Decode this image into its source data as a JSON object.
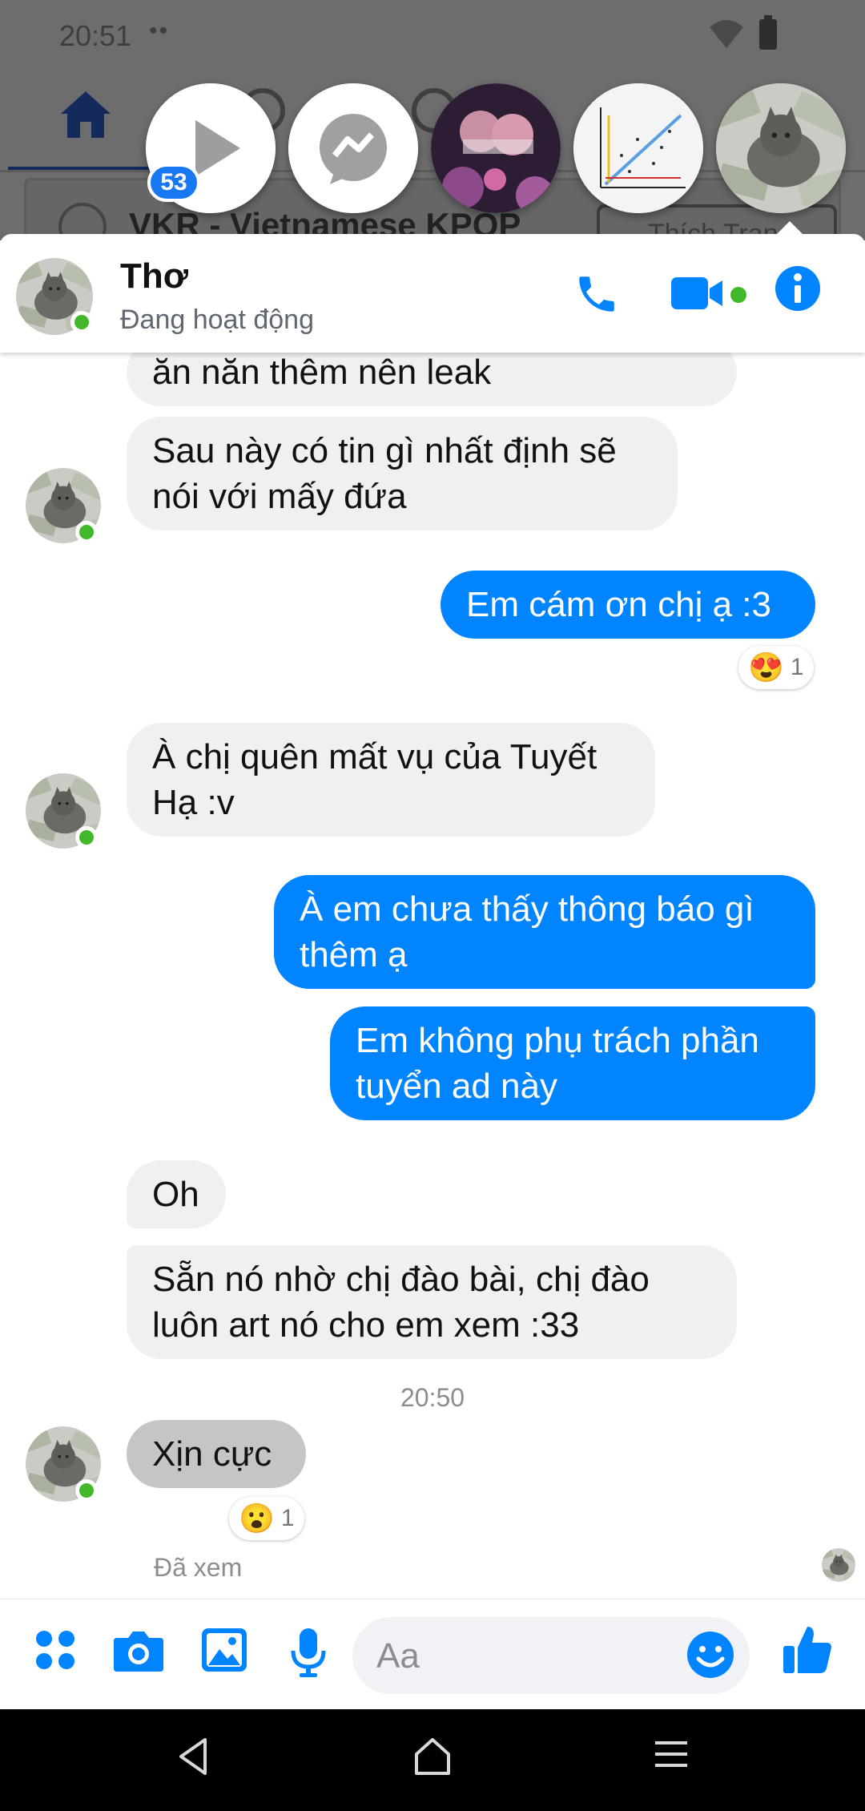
{
  "status_bar": {
    "time": "20:51",
    "indicators": "••"
  },
  "background_app": {
    "page_title": "VKR - Vietnamese KPOP",
    "like_button": "Thích Trang"
  },
  "chat_heads": {
    "badge_count": "53"
  },
  "chat_header": {
    "name": "Thơ",
    "status": "Đang hoạt động"
  },
  "messages": [
    {
      "side": "in",
      "lines": [
        "ăn năn thêm nên leak"
      ]
    },
    {
      "side": "in",
      "lines": [
        "Sau này có tin gì nhất định sẽ",
        "nói với mấy đứa"
      ]
    },
    {
      "side": "out",
      "lines": [
        "Em cám ơn chị ạ :3"
      ],
      "reaction": {
        "emoji": "😍",
        "count": "1"
      }
    },
    {
      "side": "in",
      "lines": [
        "À chị quên mất vụ của Tuyết",
        "Hạ :v"
      ]
    },
    {
      "side": "out",
      "lines": [
        "À em chưa thấy thông báo gì",
        "thêm ạ"
      ]
    },
    {
      "side": "out",
      "lines": [
        "Em không phụ trách phần",
        "tuyển ad này"
      ]
    },
    {
      "side": "in",
      "lines": [
        "Oh"
      ]
    },
    {
      "side": "in",
      "lines": [
        "Sẵn nó nhờ chị đào bài, chị đào",
        "luôn art nó cho em xem :33"
      ]
    },
    {
      "side": "in",
      "lines": [
        "Xịn cực"
      ],
      "reaction": {
        "emoji": "😮",
        "count": "1"
      }
    }
  ],
  "timestamp": "20:50",
  "seen_label": "Đã xem",
  "composer": {
    "placeholder": "Aa"
  },
  "colors": {
    "accent": "#0084ff",
    "incoming_bubble": "#f0f0f0",
    "online": "#42b72a",
    "badge": "#1877f2"
  },
  "icons": [
    "home-icon",
    "play-icon",
    "messenger-icon",
    "phone-icon",
    "video-camera-icon",
    "info-icon",
    "apps-icon",
    "camera-icon",
    "gallery-icon",
    "microphone-icon",
    "emoji-icon",
    "thumbs-up-icon",
    "back-icon",
    "home-nav-icon",
    "menu-icon"
  ]
}
